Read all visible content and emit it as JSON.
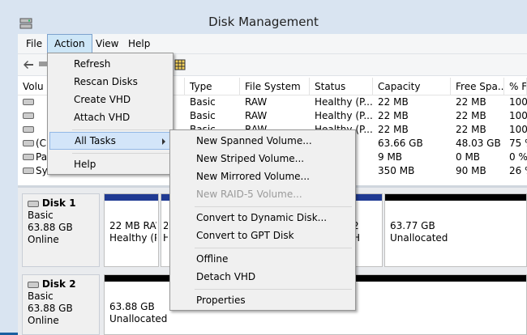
{
  "window": {
    "title": "Disk Management"
  },
  "menu": [
    "File",
    "Action",
    "View",
    "Help"
  ],
  "table": {
    "columns": [
      "Volu",
      "Type",
      "File System",
      "Status",
      "Capacity",
      "Free Spa...",
      "% F"
    ],
    "rows": [
      {
        "volume": "",
        "type": "Basic",
        "fs": "RAW",
        "status": "Healthy (P...",
        "capacity": "22 MB",
        "free": "22 MB",
        "pct": "100"
      },
      {
        "volume": "",
        "type": "Basic",
        "fs": "RAW",
        "status": "Healthy (P...",
        "capacity": "22 MB",
        "free": "22 MB",
        "pct": "100"
      },
      {
        "volume": "",
        "type": "Basic",
        "fs": "RAW",
        "status": "Healthy (P...",
        "capacity": "22 MB",
        "free": "22 MB",
        "pct": "100"
      },
      {
        "volume": "(C",
        "type": "",
        "fs": "",
        "status": "",
        "capacity": "63.66 GB",
        "free": "48.03 GB",
        "pct": "75 %"
      },
      {
        "volume": "Pa",
        "type": "",
        "fs": "",
        "status": "",
        "capacity": "9 MB",
        "free": "0 MB",
        "pct": "0 %"
      },
      {
        "volume": "Sys",
        "type": "",
        "fs": "",
        "status": "",
        "capacity": "350 MB",
        "free": "90 MB",
        "pct": "26 %"
      }
    ]
  },
  "disks": [
    {
      "name": "Disk 1",
      "kind": "Basic",
      "size": "63.88 GB",
      "state": "Online",
      "partitions": [
        {
          "line1": "22 MB RAW",
          "line2": "Healthy (P"
        },
        {
          "line1": "2",
          "line2": "H"
        },
        {
          "line1": "2",
          "line2": "H"
        },
        {
          "line1": "63.77 GB",
          "line2": "Unallocated"
        }
      ]
    },
    {
      "name": "Disk 2",
      "kind": "Basic",
      "size": "63.88 GB",
      "state": "Online",
      "partitions": [
        {
          "line1": "63.88 GB",
          "line2": "Unallocated"
        }
      ]
    }
  ],
  "action_menu": {
    "items": [
      "Refresh",
      "Rescan Disks",
      "Create VHD",
      "Attach VHD",
      "All Tasks",
      "Help"
    ]
  },
  "all_tasks_menu": {
    "items": [
      "New Spanned Volume...",
      "New Striped Volume...",
      "New Mirrored Volume...",
      "New RAID-5 Volume...",
      "Convert to Dynamic Disk...",
      "Convert to GPT Disk",
      "Offline",
      "Detach VHD",
      "Properties"
    ]
  },
  "colors": {
    "primary_bar": "#1f3a93",
    "unallocated_bar": "#000000",
    "selection": "#d3e5f9"
  }
}
